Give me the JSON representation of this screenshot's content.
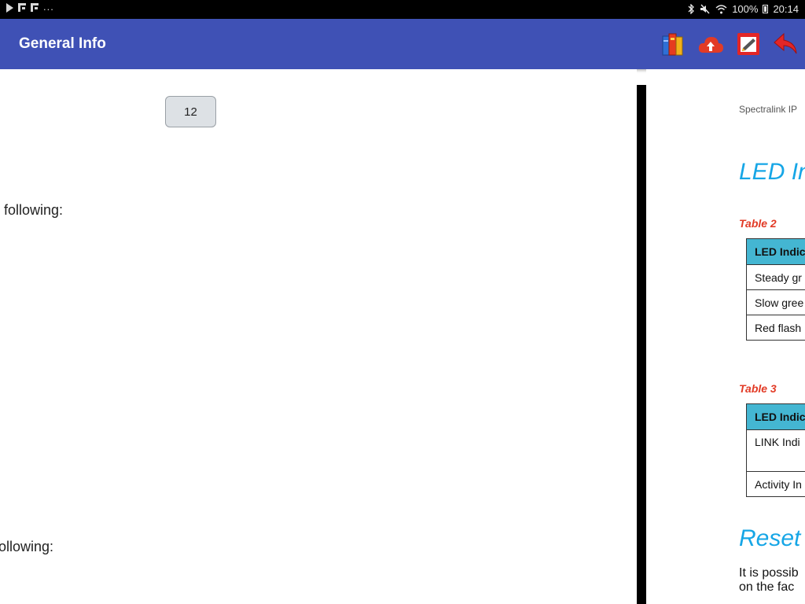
{
  "status_bar": {
    "dots": "...",
    "battery": "100%",
    "time": "20:14"
  },
  "app_bar": {
    "title": "General Info",
    "actions": [
      {
        "icon": "books-icon"
      },
      {
        "icon": "cloud-upload-icon"
      },
      {
        "icon": "edit-note-icon"
      },
      {
        "icon": "back-arrow-icon"
      }
    ]
  },
  "left_pane": {
    "page_number": "12",
    "text_1": "following:",
    "text_2": "ollowing:"
  },
  "right_pane": {
    "header": "Spectralink IP",
    "heading_1": "LED In",
    "table2": {
      "caption": "Table 2",
      "header": "LED Indic",
      "rows": [
        "Steady gr",
        "Slow gree",
        "Red flash"
      ]
    },
    "table3": {
      "caption": "Table 3",
      "header": "LED Indic",
      "rows": [
        "LINK Indi",
        "Activity In"
      ]
    },
    "heading_2": "Reset",
    "paragraph_line_1": "It is possib",
    "paragraph_line_2": "on the fac"
  },
  "colors": {
    "app_bar": "#3f51b5",
    "heading": "#16a6e6",
    "caption": "#e23b26",
    "table_header": "#44b6d2"
  }
}
